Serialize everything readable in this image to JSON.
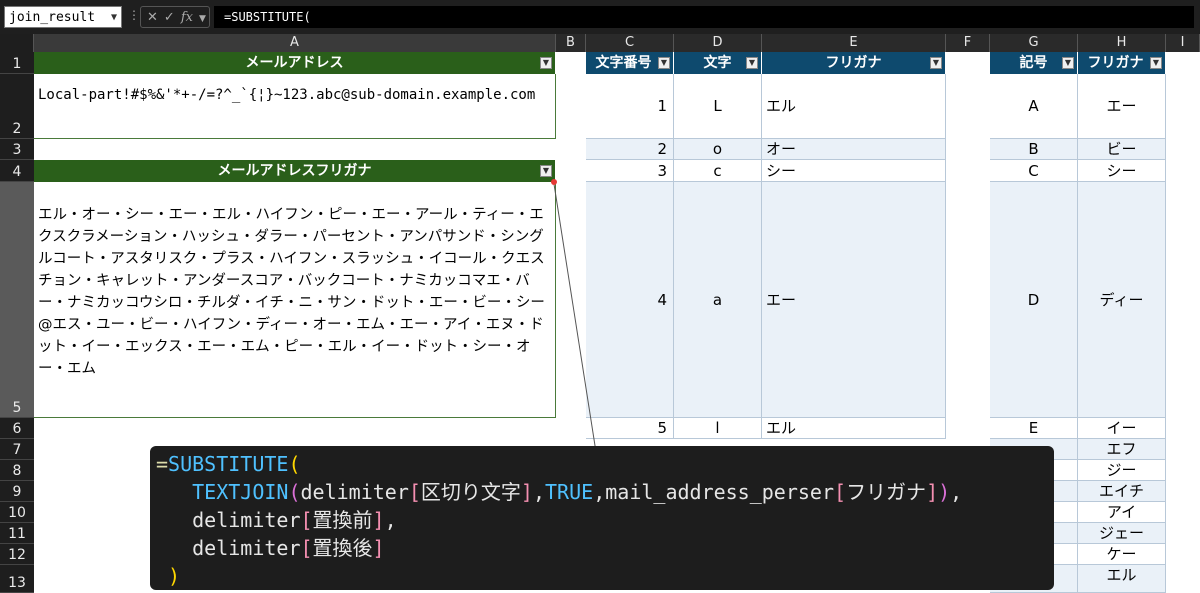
{
  "namebox": "join_result",
  "formula_text": "=SUBSTITUTE(",
  "fx_label": "fx",
  "columns": [
    "A",
    "B",
    "C",
    "D",
    "E",
    "F",
    "G",
    "H",
    "I"
  ],
  "rows": [
    "1",
    "2",
    "3",
    "4",
    "5",
    "6",
    "7",
    "8",
    "9",
    "10",
    "11",
    "12",
    "13"
  ],
  "col_a": {
    "header1": "メールアドレス",
    "email": "Local-part!#$%&'*+-/=?^_`{¦}~123.abc@sub-domain.example.com",
    "header2": "メールアドレスフリガナ",
    "furigana": "エル・オー・シー・エー・エル・ハイフン・ピー・エー・アール・ティー・エクスクラメーション・ハッシュ・ダラー・パーセント・アンパサンド・シングルコート・アスタリスク・プラス・ハイフン・スラッシュ・イコール・クエスチョン・キャレット・アンダースコア・バックコート・ナミカッコマエ・バー・ナミカッコウシロ・チルダ・イチ・ニ・サン・ドット・エー・ビー・シー@エス・ユー・ビー・ハイフン・ディー・オー・エム・エー・アイ・エヌ・ドット・イー・エックス・エー・エム・ピー・エル・イー・ドット・シー・オー・エム"
  },
  "table_chars": {
    "headers": [
      "文字番号",
      "文字",
      "フリガナ"
    ],
    "rows": [
      {
        "num": "1",
        "char": "L",
        "kana": "エル"
      },
      {
        "num": "2",
        "char": "o",
        "kana": "オー"
      },
      {
        "num": "3",
        "char": "c",
        "kana": "シー"
      },
      {
        "num": "4",
        "char": "a",
        "kana": "エー"
      },
      {
        "num": "5",
        "char": "l",
        "kana": "エル"
      }
    ]
  },
  "table_symbols": {
    "headers": [
      "記号",
      "フリガナ"
    ],
    "rows": [
      {
        "sym": "A",
        "kana": "エー"
      },
      {
        "sym": "B",
        "kana": "ビー"
      },
      {
        "sym": "C",
        "kana": "シー"
      },
      {
        "sym": "D",
        "kana": "ディー"
      },
      {
        "sym": "E",
        "kana": "イー"
      },
      {
        "sym": "",
        "kana": "エフ"
      },
      {
        "sym": "",
        "kana": "ジー"
      },
      {
        "sym": "",
        "kana": "エイチ"
      },
      {
        "sym": "",
        "kana": "アイ"
      },
      {
        "sym": "",
        "kana": "ジェー"
      },
      {
        "sym": "",
        "kana": "ケー"
      },
      {
        "sym": "",
        "kana": "エル"
      }
    ]
  },
  "tooltip": {
    "l1_eq": "=",
    "l1_fn": "SUBSTITUTE",
    "l1_paren": "(",
    "l2_indent": "   ",
    "l2_fn": "TEXTJOIN",
    "l2_paren": "(",
    "l2_arg1a": "delimiter",
    "l2_arg1b": "[",
    "l2_arg1c": "区切り文字",
    "l2_arg1d": "]",
    "l2_comma1": ",",
    "l2_true": "TRUE",
    "l2_comma2": ",",
    "l2_arg3a": "mail_address_perser",
    "l2_arg3b": "[",
    "l2_arg3c": "フリガナ",
    "l2_arg3d": "]",
    "l2_close": ")",
    "l2_comma3": ",",
    "l3_a": "delimiter",
    "l3_b": "[",
    "l3_c": "置換前",
    "l3_d": "]",
    "l3_e": ",",
    "l4_a": "delimiter",
    "l4_b": "[",
    "l4_c": "置換後",
    "l4_d": "]",
    "l5": ")"
  }
}
